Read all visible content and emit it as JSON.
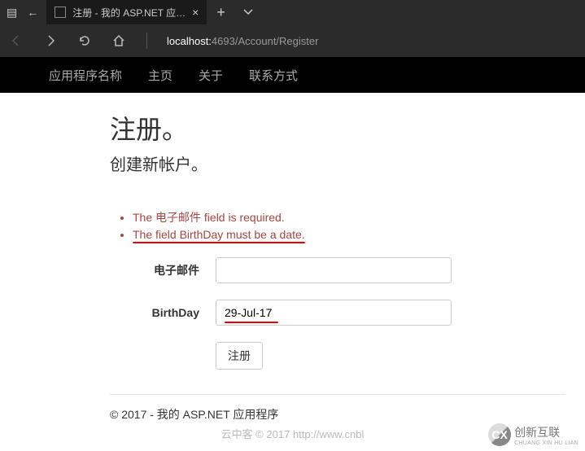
{
  "browser": {
    "tab_title": "注册 - 我的 ASP.NET 应…",
    "url_host": "localhost:",
    "url_path": "4693/Account/Register"
  },
  "navbar": {
    "brand": "应用程序名称",
    "links": [
      "主页",
      "关于",
      "联系方式"
    ]
  },
  "page": {
    "title": "注册。",
    "subtitle": "创建新帐户。"
  },
  "errors": [
    "The 电子邮件 field is required.",
    "The field BirthDay must be a date."
  ],
  "form": {
    "email_label": "电子邮件",
    "email_value": "",
    "birthday_label": "BirthDay",
    "birthday_value": "29-Jul-17",
    "submit_label": "注册"
  },
  "footer": "© 2017 - 我的 ASP.NET 应用程序",
  "watermark": {
    "brand_cn": "创新互联",
    "brand_en": "CHUANG XIN HU LIAN",
    "caption": "云中客  © 2017 http://www.cnbl"
  }
}
